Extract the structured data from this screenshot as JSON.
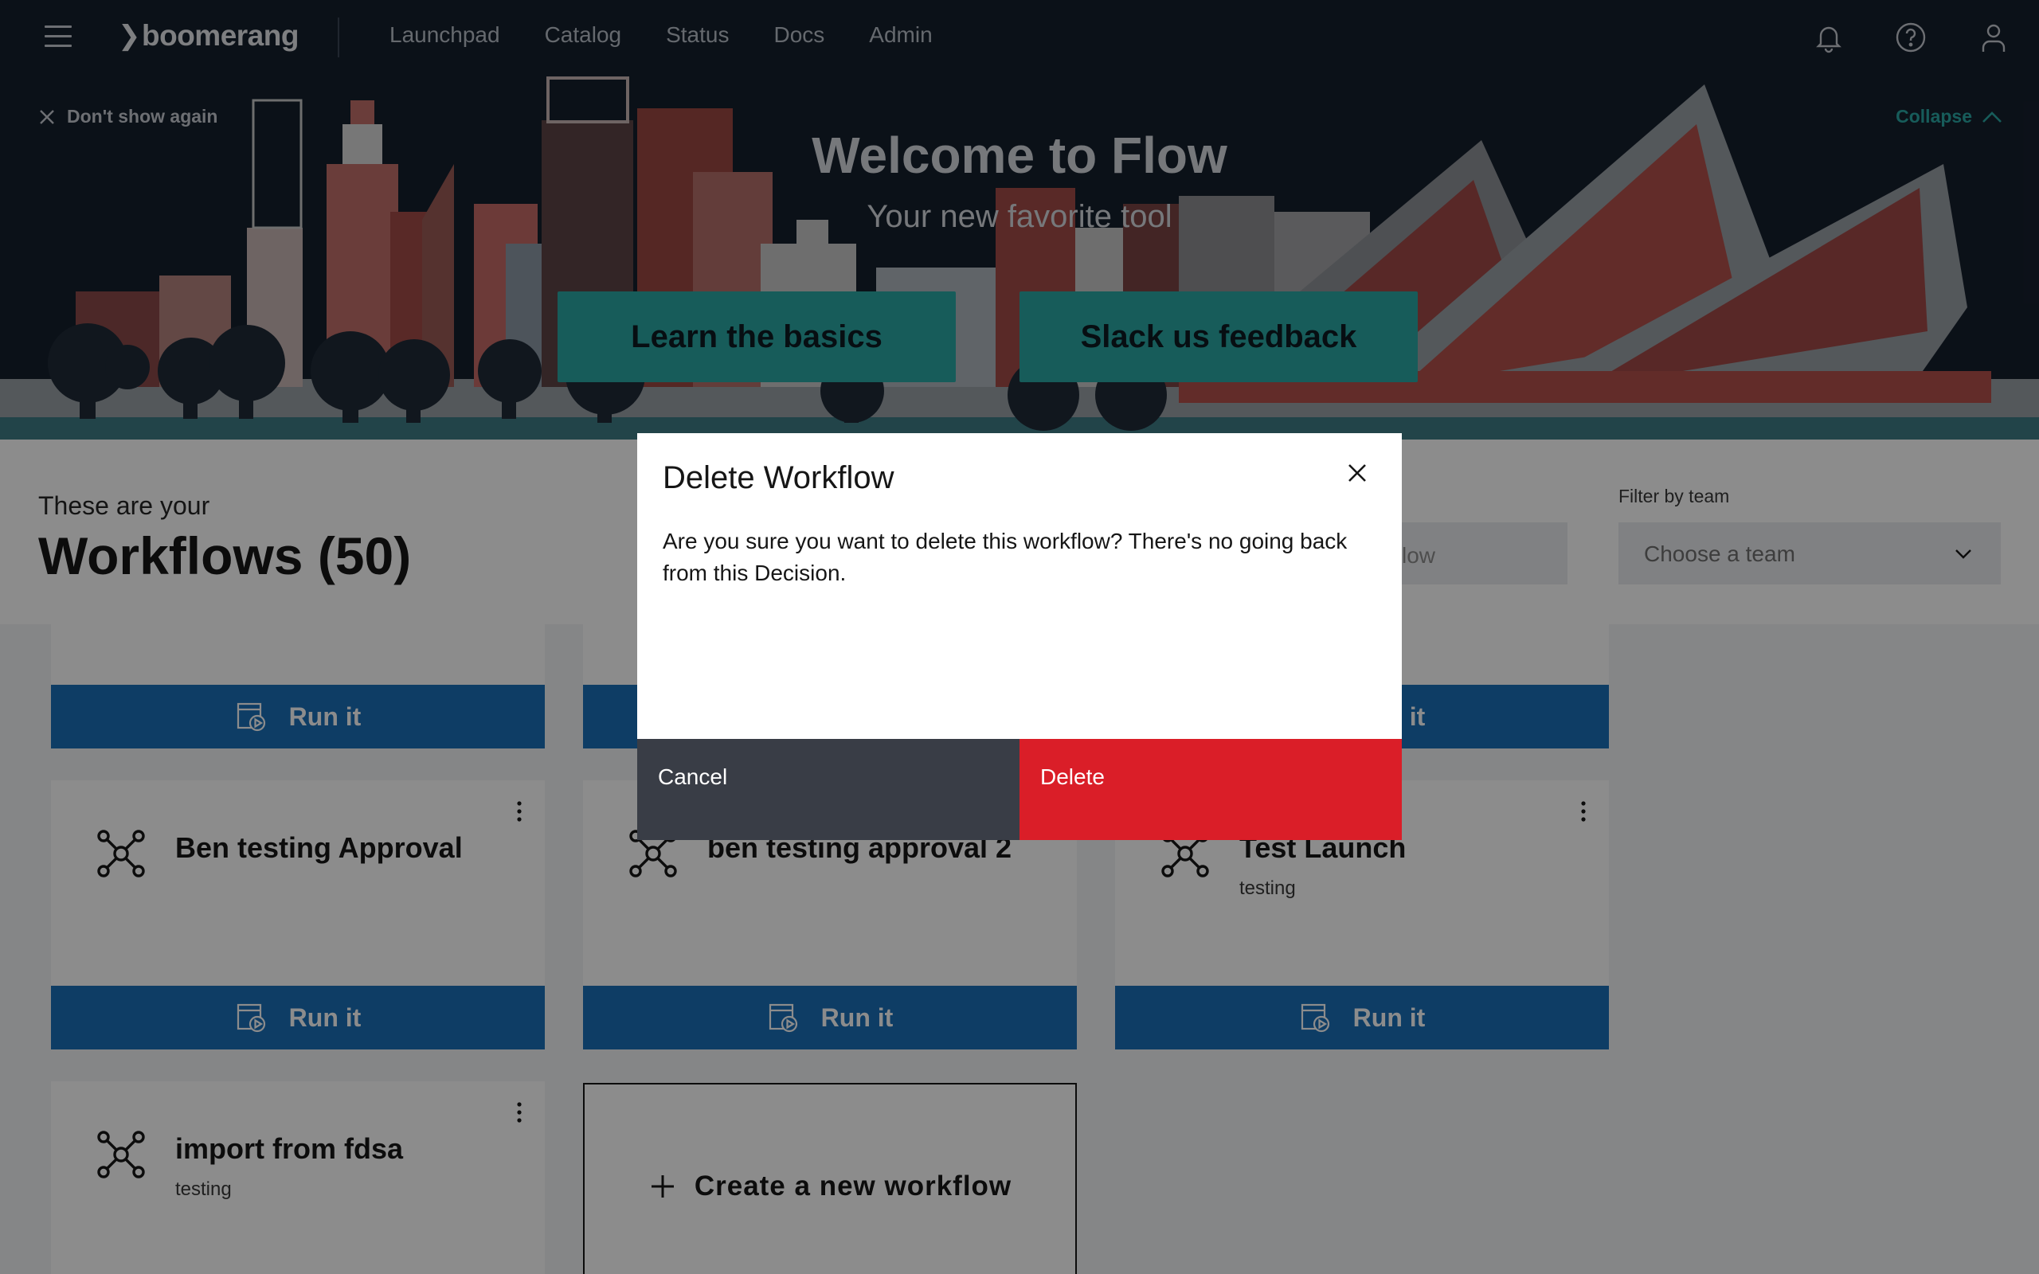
{
  "header": {
    "brand": "boomerang",
    "nav": [
      "Launchpad",
      "Catalog",
      "Status",
      "Docs",
      "Admin"
    ]
  },
  "banner": {
    "dont_show": "Don't show again",
    "collapse": "Collapse",
    "title": "Welcome to Flow",
    "subtitle": "Your new favorite tool",
    "learn_button": "Learn the basics",
    "slack_button": "Slack us feedback"
  },
  "page": {
    "intro": "These are your",
    "title": "Workflows (50)",
    "search_placeholder": "low",
    "filter_label": "Filter by team",
    "team_placeholder": "Choose a team"
  },
  "run_label": "Run it",
  "cards": [
    {
      "name": "Ben testing Approval",
      "description": ""
    },
    {
      "name": "ben testing approval 2",
      "description": ""
    },
    {
      "name": "Test Launch",
      "description": "testing"
    },
    {
      "name": "import from fdsa",
      "description": "testing"
    }
  ],
  "create_label": "Create a new workflow",
  "modal": {
    "title": "Delete Workflow",
    "body": "Are you sure you want to delete this workflow? There's no going back from this Decision.",
    "cancel": "Cancel",
    "delete": "Delete"
  },
  "colors": {
    "header_bg": "#151f2d",
    "accent_teal": "#2aa8a4",
    "run_blue": "#1b6fb8",
    "danger_red": "#da1e28",
    "cancel_gray": "#393d46"
  }
}
